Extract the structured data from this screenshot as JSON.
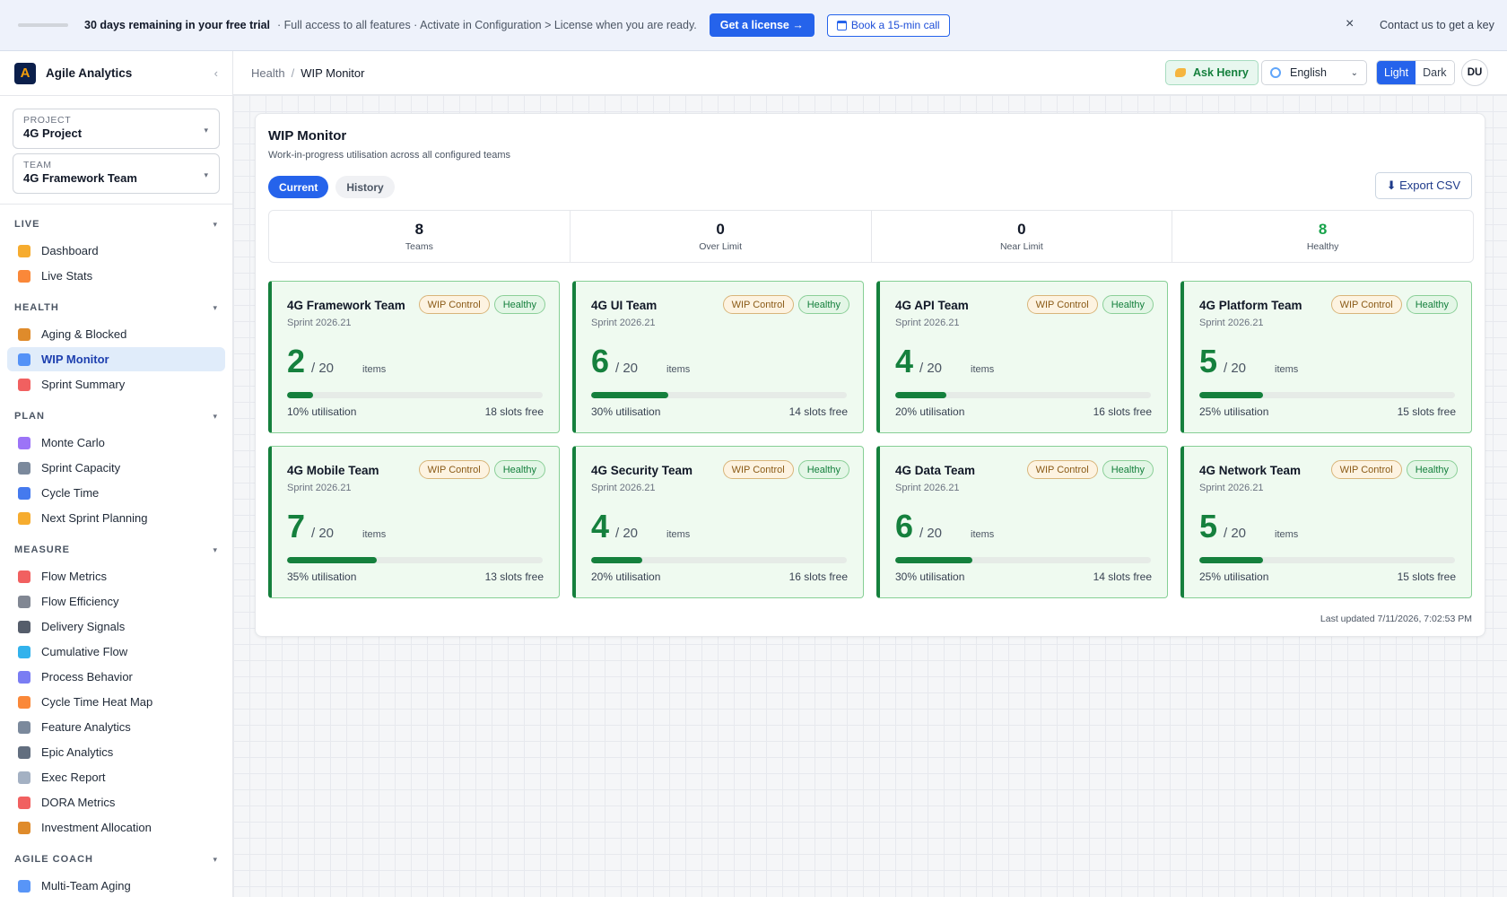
{
  "banner": {
    "days": "30 days remaining in your free trial",
    "message": "· Full access to all features · Activate in Configuration > License when you are ready.",
    "license_button": "Get a license →",
    "call_button": "Book a 15-min call",
    "close": "×",
    "contact": "Contact us to get a key"
  },
  "sidebar": {
    "app_name": "Agile Analytics",
    "logo_letter": "A",
    "collapse": "‹",
    "project": {
      "label": "PROJECT",
      "value": "4G Project"
    },
    "team": {
      "label": "TEAM",
      "value": "4G Framework Team"
    },
    "sections": [
      {
        "title": "LIVE",
        "items": [
          {
            "label": "Dashboard",
            "icon": "bar-chart-icon",
            "color": "#f59e0b"
          },
          {
            "label": "Live Stats",
            "icon": "lightning-icon",
            "color": "#f97316"
          }
        ]
      },
      {
        "title": "HEALTH",
        "items": [
          {
            "label": "Aging & Blocked",
            "icon": "hourglass-icon",
            "color": "#d97706"
          },
          {
            "label": "WIP Monitor",
            "icon": "line-chart-icon",
            "color": "#3b82f6",
            "active": true
          },
          {
            "label": "Sprint Summary",
            "icon": "clipboard-icon",
            "color": "#ef4444"
          }
        ]
      },
      {
        "title": "PLAN",
        "items": [
          {
            "label": "Monte Carlo",
            "icon": "dice-icon",
            "color": "#8b5cf6"
          },
          {
            "label": "Sprint Capacity",
            "icon": "calendar-icon",
            "color": "#64748b"
          },
          {
            "label": "Cycle Time",
            "icon": "refresh-icon",
            "color": "#2563eb"
          },
          {
            "label": "Next Sprint Planning",
            "icon": "compass-icon",
            "color": "#f59e0b"
          }
        ]
      },
      {
        "title": "MEASURE",
        "items": [
          {
            "label": "Flow Metrics",
            "icon": "trend-down-icon",
            "color": "#ef4444"
          },
          {
            "label": "Flow Efficiency",
            "icon": "stopwatch-icon",
            "color": "#6b7280"
          },
          {
            "label": "Delivery Signals",
            "icon": "traffic-light-icon",
            "color": "#374151"
          },
          {
            "label": "Cumulative Flow",
            "icon": "wave-icon",
            "color": "#0ea5e9"
          },
          {
            "label": "Process Behavior",
            "icon": "grid-icon",
            "color": "#6366f1"
          },
          {
            "label": "Cycle Time Heat Map",
            "icon": "fire-icon",
            "color": "#f97316"
          },
          {
            "label": "Feature Analytics",
            "icon": "microscope-icon",
            "color": "#64748b"
          },
          {
            "label": "Epic Analytics",
            "icon": "mountain-icon",
            "color": "#475569"
          },
          {
            "label": "Exec Report",
            "icon": "report-icon",
            "color": "#94a3b8"
          },
          {
            "label": "DORA Metrics",
            "icon": "rocket-icon",
            "color": "#ef4444"
          },
          {
            "label": "Investment Allocation",
            "icon": "money-bag-icon",
            "color": "#d97706"
          }
        ]
      },
      {
        "title": "AGILE COACH",
        "items": [
          {
            "label": "Multi-Team Aging",
            "icon": "calendar-icon",
            "color": "#3b82f6"
          }
        ]
      }
    ]
  },
  "header": {
    "breadcrumb_parent": "Health",
    "breadcrumb_sep": "/",
    "breadcrumb_current": "WIP Monitor",
    "ask_label": "Ask Henry",
    "language": "English",
    "theme_light": "Light",
    "theme_dark": "Dark",
    "avatar": "DU"
  },
  "monitor": {
    "title": "WIP Monitor",
    "subtitle": "Work-in-progress utilisation across all configured teams",
    "tab_current": "Current",
    "tab_history": "History",
    "export_label": "⬇ Export CSV",
    "summary": [
      {
        "value": "8",
        "label": "Teams"
      },
      {
        "value": "0",
        "label": "Over Limit"
      },
      {
        "value": "0",
        "label": "Near Limit"
      },
      {
        "value": "8",
        "label": "Healthy"
      }
    ],
    "updated": "Last updated 7/11/2026, 7:02:53 PM",
    "teams": [
      {
        "name": "4G Framework Team",
        "sprint": "Sprint 2026.21",
        "wip": "2",
        "limit": "/ 20",
        "items": "items",
        "util": 0.1,
        "util_label": "10% utilisation",
        "free": "18 slots free",
        "badge_wip": "WIP Control",
        "badge_status": "Healthy"
      },
      {
        "name": "4G UI Team",
        "sprint": "Sprint 2026.21",
        "wip": "6",
        "limit": "/ 20",
        "items": "items",
        "util": 0.3,
        "util_label": "30% utilisation",
        "free": "14 slots free",
        "badge_wip": "WIP Control",
        "badge_status": "Healthy"
      },
      {
        "name": "4G API Team",
        "sprint": "Sprint 2026.21",
        "wip": "4",
        "limit": "/ 20",
        "items": "items",
        "util": 0.2,
        "util_label": "20% utilisation",
        "free": "16 slots free",
        "badge_wip": "WIP Control",
        "badge_status": "Healthy"
      },
      {
        "name": "4G Platform Team",
        "sprint": "Sprint 2026.21",
        "wip": "5",
        "limit": "/ 20",
        "items": "items",
        "util": 0.25,
        "util_label": "25% utilisation",
        "free": "15 slots free",
        "badge_wip": "WIP Control",
        "badge_status": "Healthy"
      },
      {
        "name": "4G Mobile Team",
        "sprint": "Sprint 2026.21",
        "wip": "7",
        "limit": "/ 20",
        "items": "items",
        "util": 0.35,
        "util_label": "35% utilisation",
        "free": "13 slots free",
        "badge_wip": "WIP Control",
        "badge_status": "Healthy"
      },
      {
        "name": "4G Security Team",
        "sprint": "Sprint 2026.21",
        "wip": "4",
        "limit": "/ 20",
        "items": "items",
        "util": 0.2,
        "util_label": "20% utilisation",
        "free": "16 slots free",
        "badge_wip": "WIP Control",
        "badge_status": "Healthy"
      },
      {
        "name": "4G Data Team",
        "sprint": "Sprint 2026.21",
        "wip": "6",
        "limit": "/ 20",
        "items": "items",
        "util": 0.3,
        "util_label": "30% utilisation",
        "free": "14 slots free",
        "badge_wip": "WIP Control",
        "badge_status": "Healthy"
      },
      {
        "name": "4G Network Team",
        "sprint": "Sprint 2026.21",
        "wip": "5",
        "limit": "/ 20",
        "items": "items",
        "util": 0.25,
        "util_label": "25% utilisation",
        "free": "15 slots free",
        "badge_wip": "WIP Control",
        "badge_status": "Healthy"
      }
    ]
  },
  "colors": {
    "accent": "#2563eb",
    "healthy": "#15803d",
    "healthy_bg": "#effaf0"
  }
}
